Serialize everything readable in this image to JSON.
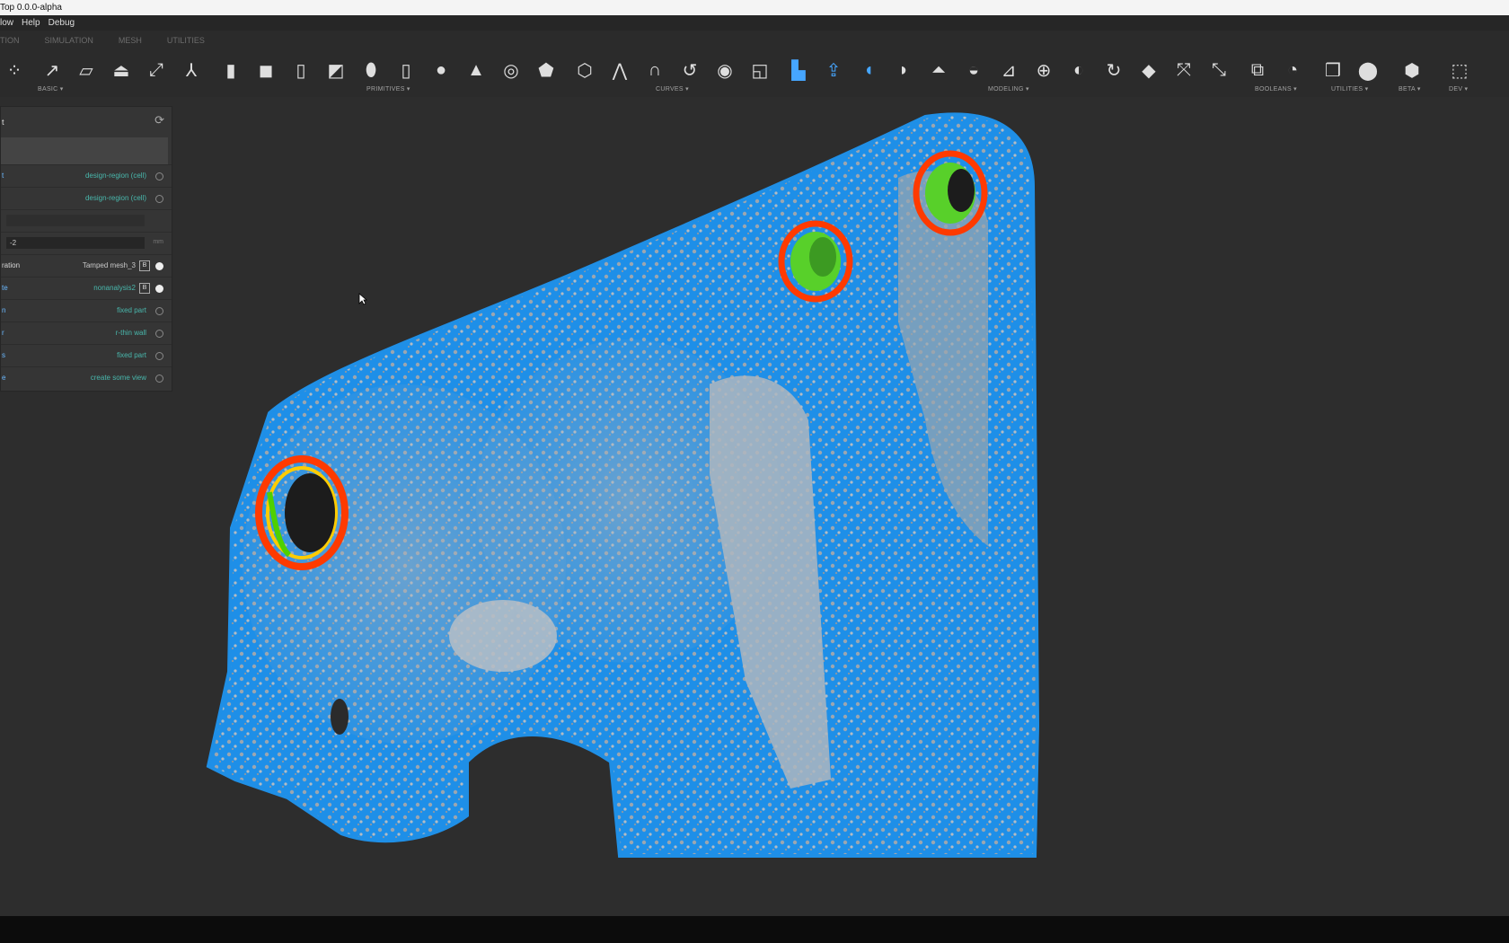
{
  "window": {
    "title": "Top 0.0.0-alpha"
  },
  "menu": [
    "low",
    "Help",
    "Debug"
  ],
  "tabs": [
    "TION",
    "SIMULATION",
    "MESH",
    "UTILITIES"
  ],
  "toolbar": {
    "groups": [
      "BASIC",
      "PRIMITIVES",
      "CURVES",
      "MODELING",
      "BOOLEANS",
      "UTILITIES",
      "BETA",
      "DEV"
    ]
  },
  "panel": {
    "title": "t",
    "rows": [
      {
        "label": "t",
        "value": "design-region (cell)"
      },
      {
        "label": "",
        "value": "design-region (cell)"
      },
      {
        "label": "",
        "value": ""
      },
      {
        "label": "",
        "input": "-2",
        "unit": "mm"
      },
      {
        "label": "ration",
        "value": "Tamped mesh_3",
        "badge": "B"
      },
      {
        "label": "te",
        "value": "nonanalysis2",
        "badge": "B"
      },
      {
        "label": "n",
        "value": "fixed part"
      },
      {
        "label": "r",
        "value": "r-thin wall"
      },
      {
        "label": "s",
        "value": "fixed part"
      },
      {
        "label": "e",
        "value": "create some view"
      }
    ]
  },
  "colors": {
    "mesh_blue": "#1f8fe6",
    "mesh_gray": "#9aa4ae",
    "ring_red": "#ff3a00",
    "ring_green": "#4fd000",
    "accent": "#46a6ff"
  }
}
